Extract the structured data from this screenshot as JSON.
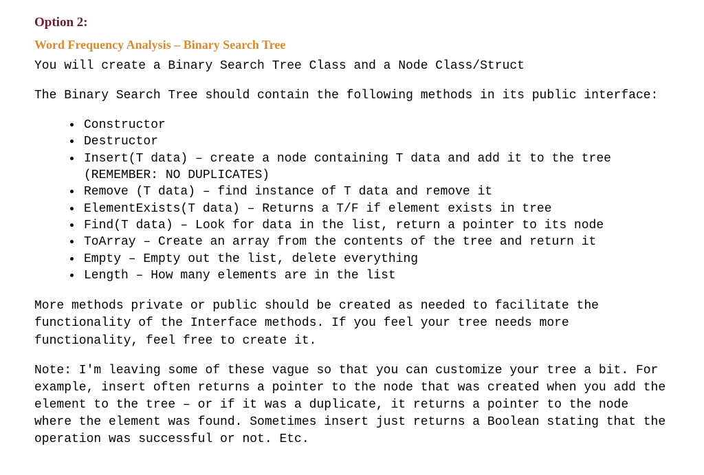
{
  "option": "Option 2:",
  "subtitle": "Word Frequency Analysis – Binary Search Tree",
  "intro": "You will create a Binary Search Tree Class and a Node Class/Struct",
  "interface_line": "The Binary Search Tree should contain the following methods in its public interface:",
  "methods": [
    "Constructor",
    "Destructor",
    "Insert(T data) – create a node containing T data and add it to the tree (REMEMBER: NO DUPLICATES)",
    "Remove (T data) – find instance of T data and remove it",
    "ElementExists(T data) – Returns a T/F if element exists in tree",
    "Find(T data) – Look for data in the list, return a pointer to its node",
    "ToArray – Create an array from the contents of the tree and return it",
    "Empty – Empty out the list, delete everything",
    "Length – How many elements are in the list"
  ],
  "more_methods": "More methods private or public should be created as needed to facilitate the functionality of the Interface methods.  If you feel your tree needs more functionality, feel free to create it.",
  "note": "Note: I'm leaving some of these vague so that you can customize your tree a bit.  For example, insert often returns a pointer to the node that was created when you add the element to the tree – or if it was a duplicate, it returns a pointer to the node where the element was found.  Sometimes insert just returns a Boolean stating that the operation was successful or not.  Etc."
}
